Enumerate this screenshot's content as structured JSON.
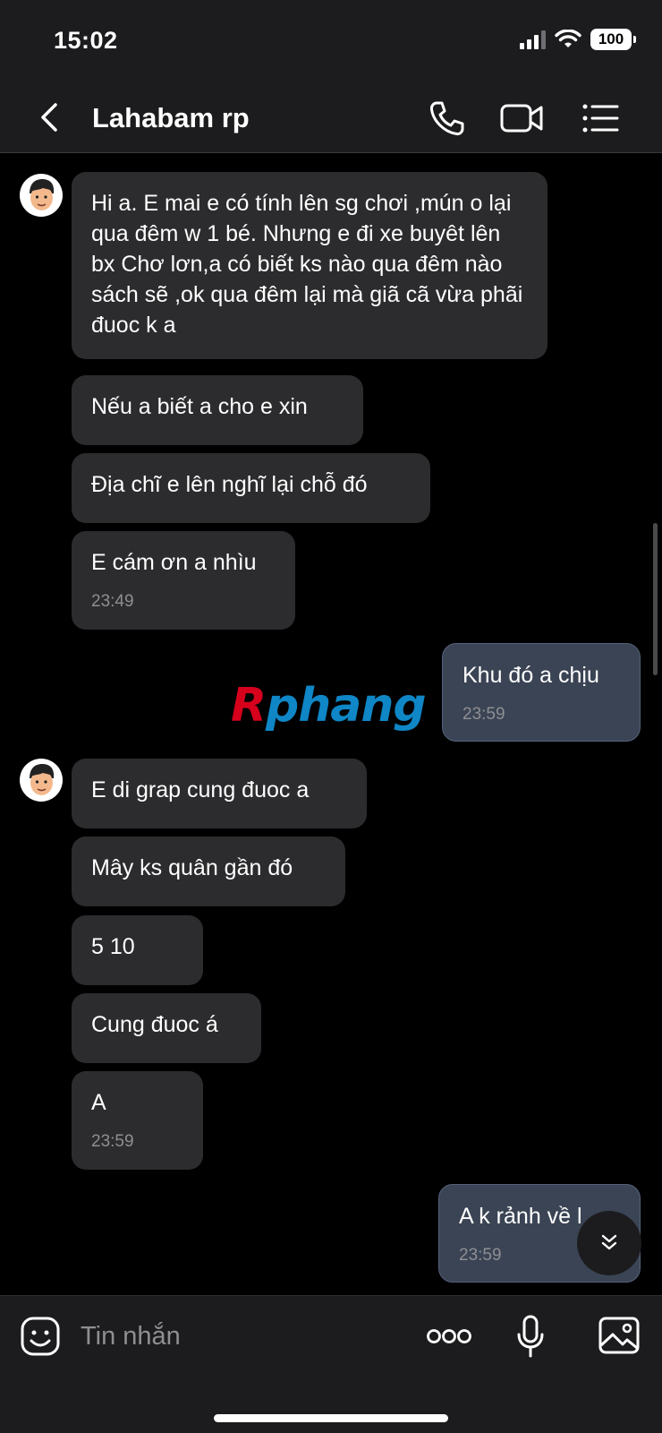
{
  "status_bar": {
    "time": "15:02",
    "battery": "100"
  },
  "header": {
    "contact_name": "Lahabam rp"
  },
  "watermark": {
    "first": "R",
    "rest": "phang"
  },
  "messages": {
    "m1": "Hi a. E mai e có tính lên sg chơi ,mún o lại qua đêm w 1 bé. Nhưng e đi xe buyêt lên bx Chơ lơn,a có biết ks nào qua đêm nào sách sẽ ,ok qua đêm lại mà giã cã vừa phãi đuoc k a",
    "m2": "Nếu a biết a cho e xin",
    "m3": "Địa chĩ e lên nghĩ lại chỗ đó",
    "m4": "E cám ơn a nhìu",
    "m4_time": "23:49",
    "m5": "Khu đó a chịu",
    "m5_time": "23:59",
    "m6": "E di grap cung đuoc a",
    "m7": "Mây ks quân gần đó",
    "m8": "5 10",
    "m9": "Cung đuoc á",
    "m10": "A",
    "m10_time": "23:59",
    "m11": "A k rảnh về l",
    "m11_time": "23:59"
  },
  "composer": {
    "placeholder": "Tin nhắn"
  }
}
